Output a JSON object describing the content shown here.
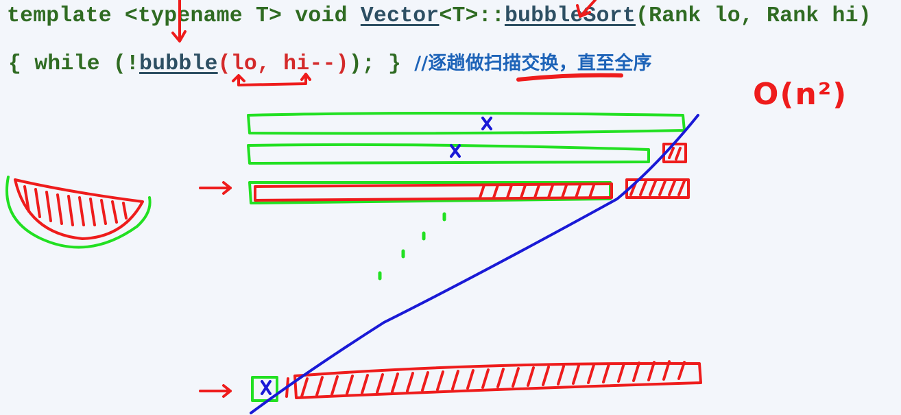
{
  "code": {
    "line1": {
      "prefix": "template <typename T> void ",
      "class_name": "Vector",
      "template_arg": "<T>::",
      "method": "bubbleSort",
      "params": "(Rank lo, Rank hi)"
    },
    "line2": {
      "open": "{ while (!",
      "call": "bubble",
      "args": "(lo, hi--)",
      "close": "); } ",
      "comment": "//逐趟做扫描交换，直至全序"
    }
  },
  "annotations": {
    "complexity": "O(n²)"
  },
  "colors": {
    "code": "#2f6b22",
    "identifier": "#2d4f63",
    "highlight": "#d42a2a",
    "comment": "#1d63b8",
    "ink_green": "#22e022",
    "ink_red": "#ee1c1c",
    "ink_blue": "#1a1ad6",
    "background": "#f3f6fb"
  }
}
